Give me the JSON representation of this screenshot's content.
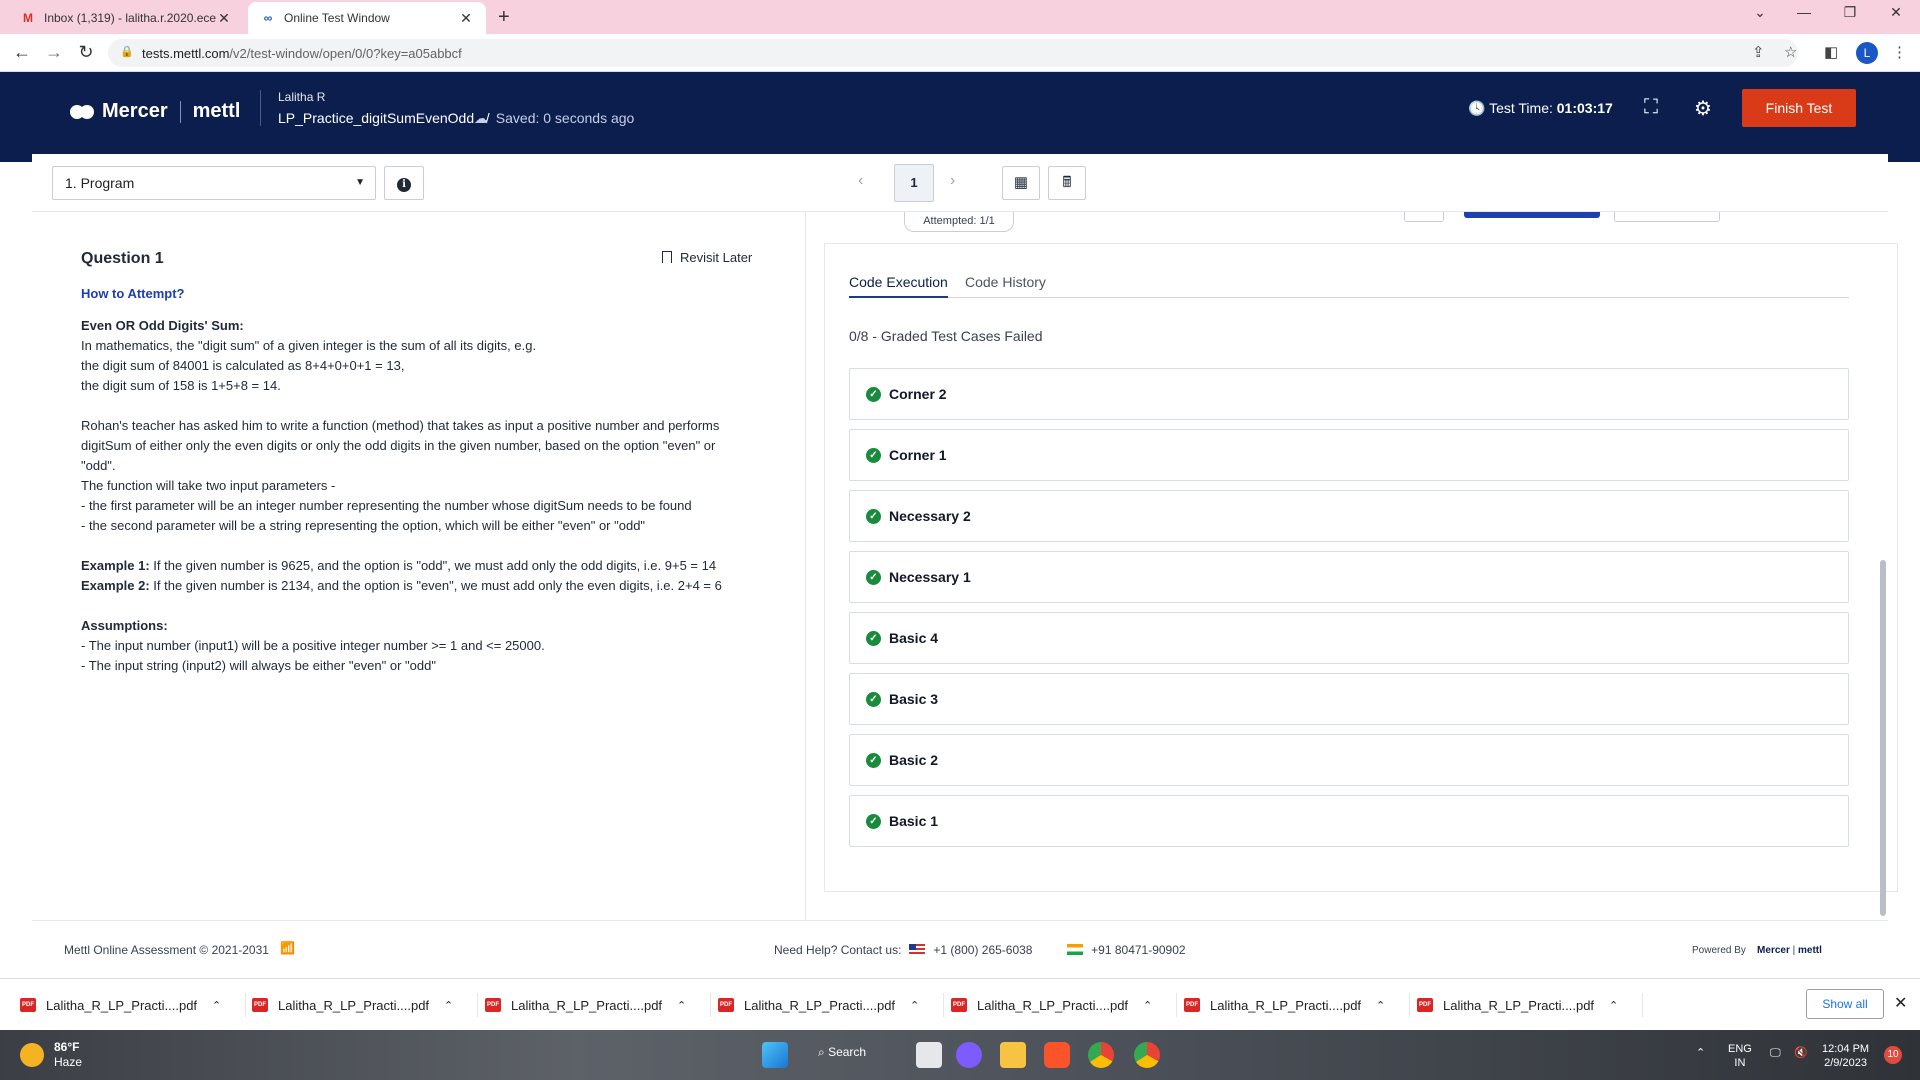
{
  "browser": {
    "tabs": [
      {
        "title": "Inbox (1,319) - lalitha.r.2020.ece@",
        "active": false
      },
      {
        "title": "Online Test Window",
        "active": true
      }
    ],
    "url_host": "tests.mettl.com",
    "url_path": "/v2/test-window/open/0/0?key=a05abbcf",
    "profile_initial": "L"
  },
  "header": {
    "brand_mercer": "Mercer",
    "brand_mettl": "mettl",
    "user_name": "Lalitha R",
    "test_name": "LP_Practice_digitSumEvenOdd",
    "separator": "/",
    "saved_status": "Saved: 0 seconds ago",
    "timer_label": "Test Time:",
    "timer_value": "01:03:17",
    "finish_label": "Finish Test"
  },
  "toolbar": {
    "question_select": "1. Program",
    "current_page": "1"
  },
  "question": {
    "title": "Question 1",
    "revisit_label": "Revisit Later",
    "how_to": "How to Attempt?",
    "heading": "Even OR Odd Digits' Sum:",
    "intro": "In mathematics, the \"digit sum\" of a given integer is the sum of all its digits, e.g.\nthe digit sum of 84001 is calculated as 8+4+0+0+1 = 13,\nthe digit sum of 158 is 1+5+8 = 14.",
    "body": "Rohan's teacher has asked him to write a function (method) that takes as input a positive number and performs\ndigitSum of either only the even digits or only the odd digits in the given number, based on the option \"even\" or\n\"odd\".\nThe function will take two input parameters -\n- the first parameter will be an integer number representing the number whose digitSum needs to be found\n- the second parameter will be a string representing the option, which will be either \"even\" or \"odd\"",
    "example1_label": "Example 1:",
    "example1_text": " If the given number is 9625, and the option is \"odd\", we must add only the odd digits, i.e. 9+5 = 14",
    "example2_label": "Example 2:",
    "example2_text": " If the given number is 2134, and the option is \"even\", we must add only the even digits, i.e. 2+4 = 6",
    "assumptions_label": "Assumptions:",
    "assumptions": "- The input number (input1) will be a positive integer number >= 1 and <= 25000.\n- The input string (input2) will always be either \"even\" or \"odd\""
  },
  "execution": {
    "attempted": "Attempted: 1/1",
    "tabs": [
      "Code Execution",
      "Code History"
    ],
    "summary": "0/8 - Graded Test Cases Failed",
    "cases": [
      "Corner 2",
      "Corner 1",
      "Necessary 2",
      "Necessary 1",
      "Basic 4",
      "Basic 3",
      "Basic 2",
      "Basic 1"
    ]
  },
  "footer": {
    "copyright": "Mettl Online Assessment © 2021-2031",
    "help_label": "Need Help? Contact us:",
    "phone_us": "+1 (800) 265-6038",
    "phone_in": "+91 80471-90902",
    "powered_by": "Powered By",
    "powered_mercer": "Mercer",
    "powered_mettl": "mettl"
  },
  "downloads": {
    "items": [
      "Lalitha_R_LP_Practi....pdf",
      "Lalitha_R_LP_Practi....pdf",
      "Lalitha_R_LP_Practi....pdf",
      "Lalitha_R_LP_Practi....pdf",
      "Lalitha_R_LP_Practi....pdf",
      "Lalitha_R_LP_Practi....pdf",
      "Lalitha_R_LP_Practi....pdf"
    ],
    "show_all": "Show all"
  },
  "taskbar": {
    "temperature": "86°F",
    "condition": "Haze",
    "search": "Search",
    "lang": "ENG",
    "region": "IN",
    "time": "12:04 PM",
    "date": "2/9/2023",
    "notifications": "10"
  }
}
